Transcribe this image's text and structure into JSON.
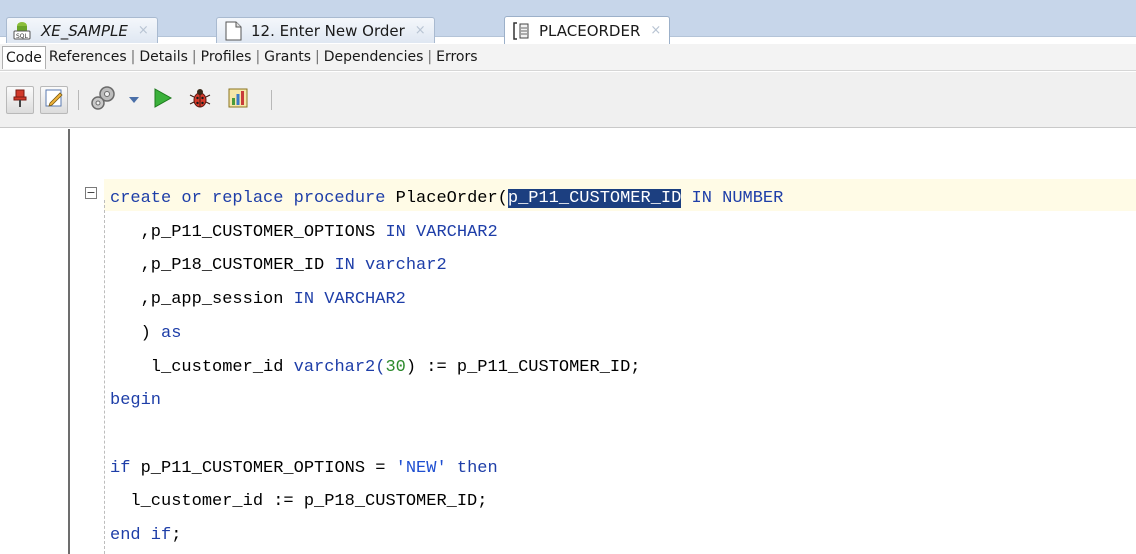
{
  "tabs": [
    {
      "label": "XE_SAMPLE",
      "icon": "sql-connection-icon",
      "active": false
    },
    {
      "label": "12. Enter New Order",
      "icon": "page-icon",
      "active": false
    },
    {
      "label": "PLACEORDER",
      "icon": "procedure-icon",
      "active": true
    }
  ],
  "tab_close_glyph": "×",
  "subtabs": [
    "Code",
    "References",
    "Details",
    "Profiles",
    "Grants",
    "Dependencies",
    "Errors"
  ],
  "toolbar": {
    "icons": [
      "pin-icon",
      "edit-icon",
      "compile-icon",
      "dropdown-arrow-icon",
      "run-icon",
      "debug-icon",
      "profile-icon"
    ]
  },
  "code": {
    "line1_a": "create or replace procedure",
    "line1_b": " PlaceOrder(",
    "line1_sel": "p_P11_CUSTOMER_ID",
    "line1_c": " IN NUMBER",
    "line2_a": "   ,p_P11_CUSTOMER_OPTIONS ",
    "line2_b": "IN VARCHAR2",
    "line3_a": "   ,p_P18_CUSTOMER_ID ",
    "line3_b": "IN varchar2",
    "line4_a": "   ,p_app_session ",
    "line4_b": "IN VARCHAR2",
    "line5_a": "   ) ",
    "line5_b": "as",
    "line6_a": "    l_customer_id ",
    "line6_b": "varchar2(",
    "line6_num": "30",
    "line6_c": ") := p_P11_CUSTOMER_ID;",
    "line7": "begin",
    "line8": "",
    "line9_a": "if",
    "line9_b": " p_P11_CUSTOMER_OPTIONS = ",
    "line9_str": "'NEW'",
    "line9_c": " then",
    "line10": "  l_customer_id := p_P18_CUSTOMER_ID;",
    "line11_a": "end if",
    "line11_b": ";"
  },
  "colors": {
    "keyword": "#1e3ea8",
    "string": "#1f4fd1",
    "number": "#2c8a2c",
    "selection": "#1c3f80"
  }
}
